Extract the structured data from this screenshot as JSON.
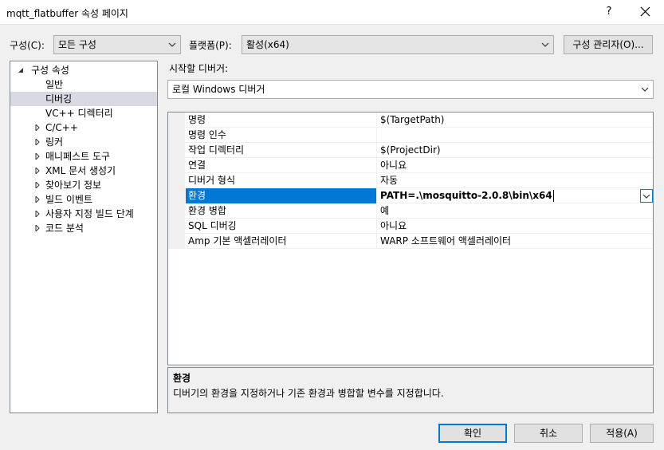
{
  "window": {
    "title": "mqtt_flatbuffer 속성 페이지",
    "help_label": "?"
  },
  "toolbar": {
    "config_label": "구성(C):",
    "config_value": "모든 구성",
    "platform_label": "플랫폼(P):",
    "platform_value": "활성(x64)",
    "config_manager_label": "구성 관리자(O)..."
  },
  "tree": {
    "items": [
      {
        "label": "구성 속성",
        "expanded": true
      },
      {
        "label": "일반"
      },
      {
        "label": "디버깅",
        "selected": true
      },
      {
        "label": "VC++ 디렉터리"
      },
      {
        "label": "C/C++",
        "expandable": true
      },
      {
        "label": "링커",
        "expandable": true
      },
      {
        "label": "매니페스트 도구",
        "expandable": true
      },
      {
        "label": "XML 문서 생성기",
        "expandable": true
      },
      {
        "label": "찾아보기 정보",
        "expandable": true
      },
      {
        "label": "빌드 이벤트",
        "expandable": true
      },
      {
        "label": "사용자 지정 빌드 단계",
        "expandable": true
      },
      {
        "label": "코드 분석",
        "expandable": true
      }
    ]
  },
  "debugger": {
    "label": "시작할 디버거:",
    "value": "로컬 Windows 디버거"
  },
  "grid": {
    "rows": [
      {
        "name": "명령",
        "value": "$(TargetPath)"
      },
      {
        "name": "명령 인수",
        "value": ""
      },
      {
        "name": "작업 디렉터리",
        "value": "$(ProjectDir)"
      },
      {
        "name": "연결",
        "value": "아니요"
      },
      {
        "name": "디버거 형식",
        "value": "자동"
      },
      {
        "name": "환경",
        "value": "PATH=.\\mosquitto-2.0.8\\bin\\x64",
        "selected": true
      },
      {
        "name": "환경 병합",
        "value": "예"
      },
      {
        "name": "SQL 디버깅",
        "value": "아니요"
      },
      {
        "name": "Amp 기본 액셀러레이터",
        "value": "WARP 소프트웨어 액셀러레이터"
      }
    ]
  },
  "description": {
    "title": "환경",
    "text": "디버기의 환경을 지정하거나 기존 환경과 병합할 변수를 지정합니다."
  },
  "buttons": {
    "ok": "확인",
    "cancel": "취소",
    "apply": "적용(A)"
  },
  "colors": {
    "accent": "#0078d7",
    "selection": "#cce4f7",
    "dialog_bg": "#f0f0f0"
  }
}
